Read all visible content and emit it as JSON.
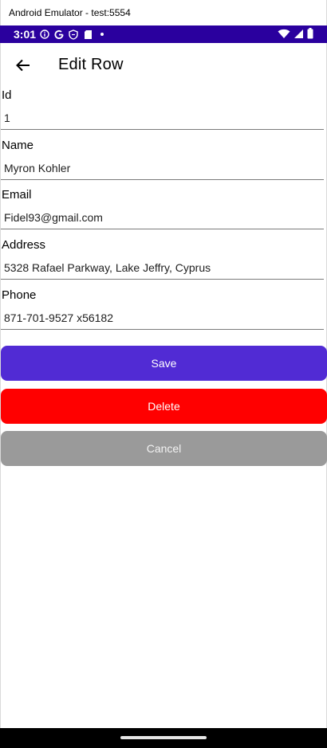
{
  "window": {
    "title": "Android Emulator - test:5554"
  },
  "status_bar": {
    "time": "3:01",
    "icons_left": [
      "info-icon",
      "google-icon",
      "shield-icon",
      "sd-card-icon",
      "dot-icon"
    ],
    "icons_right": [
      "wifi-icon",
      "signal-icon",
      "battery-icon"
    ],
    "color": "#2a009e"
  },
  "toolbar": {
    "title": "Edit Row",
    "back_icon": "arrow-left-icon"
  },
  "form": {
    "fields": [
      {
        "label": "Id",
        "value": "1"
      },
      {
        "label": "Name",
        "value": "Myron Kohler"
      },
      {
        "label": "Email",
        "value": "Fidel93@gmail.com"
      },
      {
        "label": "Address",
        "value": "5328 Rafael Parkway, Lake Jeffry, Cyprus"
      },
      {
        "label": "Phone",
        "value": "871-701-9527 x56182"
      }
    ]
  },
  "buttons": {
    "save": {
      "label": "Save",
      "color": "#512bd4"
    },
    "delete": {
      "label": "Delete",
      "color": "#ff0000"
    },
    "cancel": {
      "label": "Cancel",
      "color": "#9a9a9a"
    }
  }
}
